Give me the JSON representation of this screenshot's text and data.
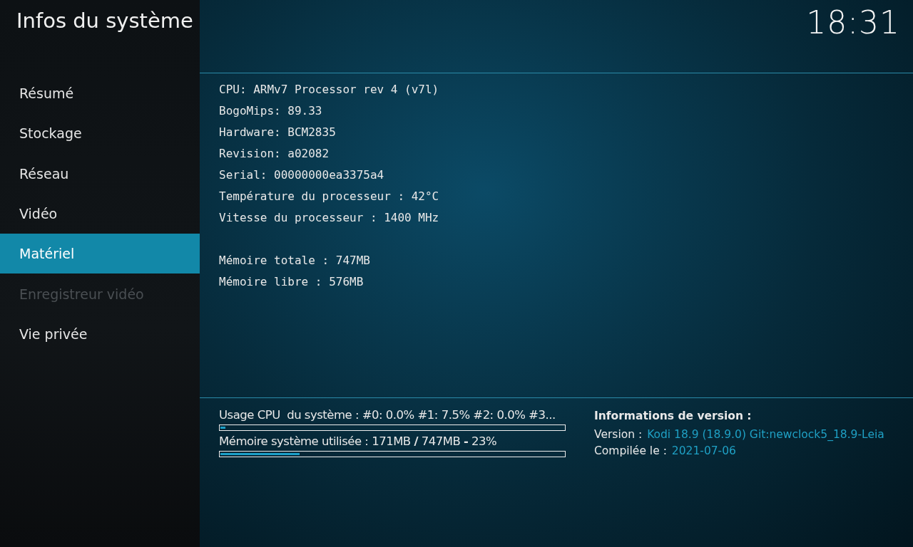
{
  "window": {
    "title": "Infos du système",
    "clock": "18:31"
  },
  "sidebar": {
    "items": [
      {
        "label": "Résumé",
        "selected": false,
        "disabled": false
      },
      {
        "label": "Stockage",
        "selected": false,
        "disabled": false
      },
      {
        "label": "Réseau",
        "selected": false,
        "disabled": false
      },
      {
        "label": "Vidéo",
        "selected": false,
        "disabled": false
      },
      {
        "label": "Matériel",
        "selected": true,
        "disabled": false
      },
      {
        "label": "Enregistreur vidéo",
        "selected": false,
        "disabled": true
      },
      {
        "label": "Vie privée",
        "selected": false,
        "disabled": false
      }
    ]
  },
  "hardware_info": [
    "CPU: ARMv7 Processor rev 4 (v7l)",
    "BogoMips: 89.33",
    "Hardware: BCM2835",
    "Revision: a02082",
    "Serial: 00000000ea3375a4",
    "Température du processeur : 42°C",
    "Vitesse du processeur : 1400 MHz"
  ],
  "memory_info": [
    "Mémoire totale : 747MB",
    "Mémoire libre : 576MB"
  ],
  "meters": [
    {
      "label": "Usage CPU  du système : #0: 0.0% #1: 7.5% #2: 0.0% #3...",
      "level": 0.015
    },
    {
      "label": "Mémoire système utilisée : 171MB **/** 747MB **-** 23%",
      "level": 0.23
    }
  ],
  "version_info": {
    "heading": "Informations de version :",
    "rows": [
      {
        "label": "Version :",
        "value": "Kodi 18.9 (18.9.0) Git:newclock5_18.9-Leia"
      },
      {
        "label": "Compilée le :",
        "value": "2021-07-06"
      }
    ]
  }
}
